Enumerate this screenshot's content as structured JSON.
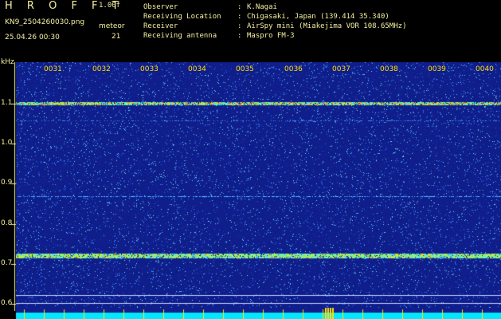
{
  "app": {
    "brand": "H R O F F T",
    "version": "1.00f",
    "file_name": "KN9_2504260030.png",
    "datetime": "25.04.26 00:30",
    "meteor_label": "meteor",
    "meteor_count": "21"
  },
  "meta": [
    {
      "key": "Observer",
      "value": "K.Nagai"
    },
    {
      "key": "Receiving Location",
      "value": "Chigasaki, Japan (139.414 35.340)"
    },
    {
      "key": "Receiver",
      "value": "AirSpy mini (Miakejima VOR 108.65MHz)"
    },
    {
      "key": "Receiving antenna",
      "value": "Maspro FM-3"
    }
  ],
  "axis": {
    "unit": "kHz",
    "freq_ticks": [
      "1.1",
      "1.0",
      "0.9",
      "0.8",
      "0.7",
      "0.6"
    ],
    "time_ticks": [
      "0031",
      "0032",
      "0033",
      "0034",
      "0035",
      "0036",
      "0037",
      "0038",
      "0039",
      "0040"
    ]
  },
  "colors": {
    "background": "#000000",
    "plot_bg": "#0f1e8a",
    "label": "#f5f0a0",
    "time_label": "#ffe000",
    "bottom_bar": "#00e8ff"
  }
}
